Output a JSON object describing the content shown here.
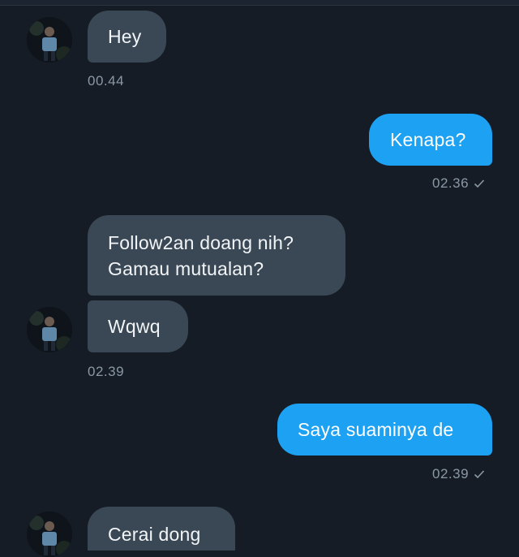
{
  "messages": {
    "m1": {
      "text": "Hey",
      "time": "00.44"
    },
    "m2": {
      "text": "Kenapa?",
      "time": "02.36"
    },
    "m3": {
      "line1": "Follow2an doang nih?",
      "line2": "Gamau mutualan?"
    },
    "m4": {
      "text": "Wqwq",
      "time": "02.39"
    },
    "m5": {
      "text": "Saya suaminya de",
      "time": "02.39"
    },
    "m6": {
      "text": "Cerai dong"
    }
  },
  "colors": {
    "background": "#151c26",
    "incoming_bubble": "#3a4754",
    "outgoing_bubble": "#1da1f2",
    "timestamp": "#8b98a5"
  },
  "icons": {
    "read_receipt": "check-icon",
    "contact_avatar": "avatar"
  }
}
